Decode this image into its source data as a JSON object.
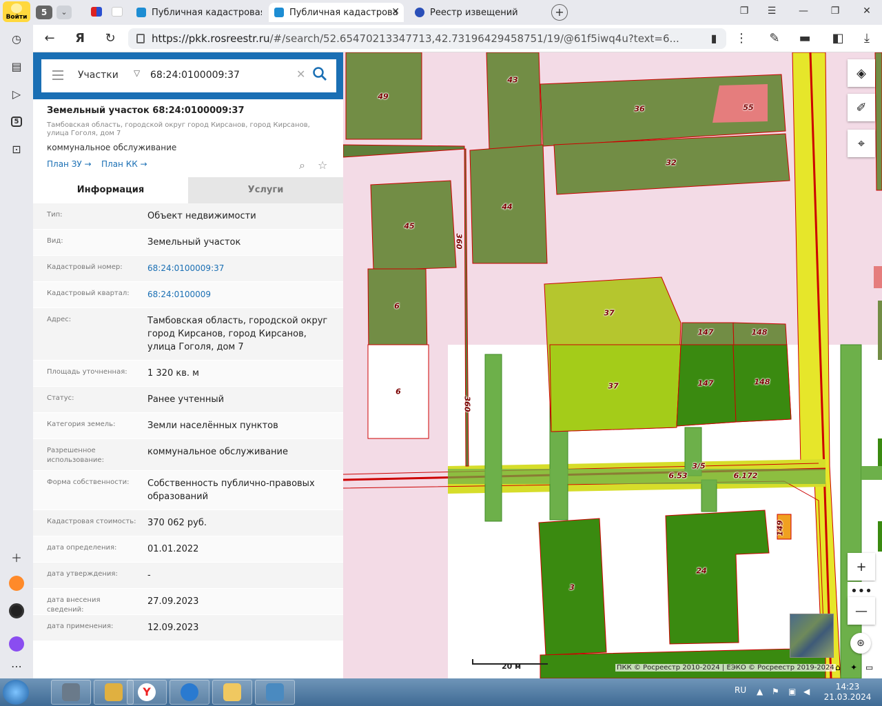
{
  "browser": {
    "login_label": "Войти",
    "tab_count": "5",
    "tabs": [
      {
        "title": "Публичная кадастровая к"
      },
      {
        "title": "Публичная кадастрова"
      },
      {
        "title": "Реестр извещений"
      }
    ],
    "url_host": "https://pkk.rosreestr.ru",
    "url_rest": "/#/search/52.65470213347713,42.73196429458751/19/@61f5iwq4u?text=6..."
  },
  "search": {
    "type": "Участки",
    "value": "68:24:0100009:37"
  },
  "object": {
    "title": "Земельный участок 68:24:0100009:37",
    "address": "Тамбовская область, городской округ город Кирсанов, город Кирсанов, улица Гоголя, дом 7",
    "usage": "коммунальное обслуживание",
    "link_plan_zu": "План ЗУ →",
    "link_plan_kk": "План КК →"
  },
  "info_tabs": {
    "info": "Информация",
    "services": "Услуги"
  },
  "fields": [
    {
      "label": "Тип:",
      "value": "Объект недвижимости"
    },
    {
      "label": "Вид:",
      "value": "Земельный участок"
    },
    {
      "label": "Кадастровый номер:",
      "value": "68:24:0100009:37",
      "link": true
    },
    {
      "label": "Кадастровый квартал:",
      "value": "68:24:0100009",
      "link": true
    },
    {
      "label": "Адрес:",
      "value": "Тамбовская область, городской округ город Кирсанов, город Кирсанов, улица Гоголя, дом 7"
    },
    {
      "label": "Площадь уточненная:",
      "value": "1 320 кв. м"
    },
    {
      "label": "Статус:",
      "value": "Ранее учтенный"
    },
    {
      "label": "Категория земель:",
      "value": "Земли населённых пунктов"
    },
    {
      "label": "Разрешенное использование:",
      "value": "коммунальное обслуживание"
    },
    {
      "label": "Форма собственности:",
      "value": "Собственность публично-правовых образований"
    },
    {
      "label": "Кадастровая стоимость:",
      "value": "370 062 руб."
    },
    {
      "label": "дата определения:",
      "value": "01.01.2022"
    },
    {
      "label": "дата утверждения:",
      "value": "-"
    },
    {
      "label": "дата внесения сведений:",
      "value": "27.09.2023"
    },
    {
      "label": "дата применения:",
      "value": "12.09.2023"
    }
  ],
  "map": {
    "parcel_labels": [
      "49",
      "43",
      "36",
      "55",
      "32",
      "45",
      "44",
      "360",
      "6",
      "6",
      "37",
      "37",
      "147",
      "147",
      "148",
      "148",
      "360",
      "3/5",
      "6.53",
      "6.172",
      "149",
      "3",
      "24"
    ],
    "scale_label": "20 м",
    "copyright": "ПКК © Росреестр 2010-2024 | ЕЭКО © Росреестр 2019-2024"
  },
  "taskbar": {
    "lang": "RU",
    "time": "14:23",
    "date": "21.03.2024"
  }
}
